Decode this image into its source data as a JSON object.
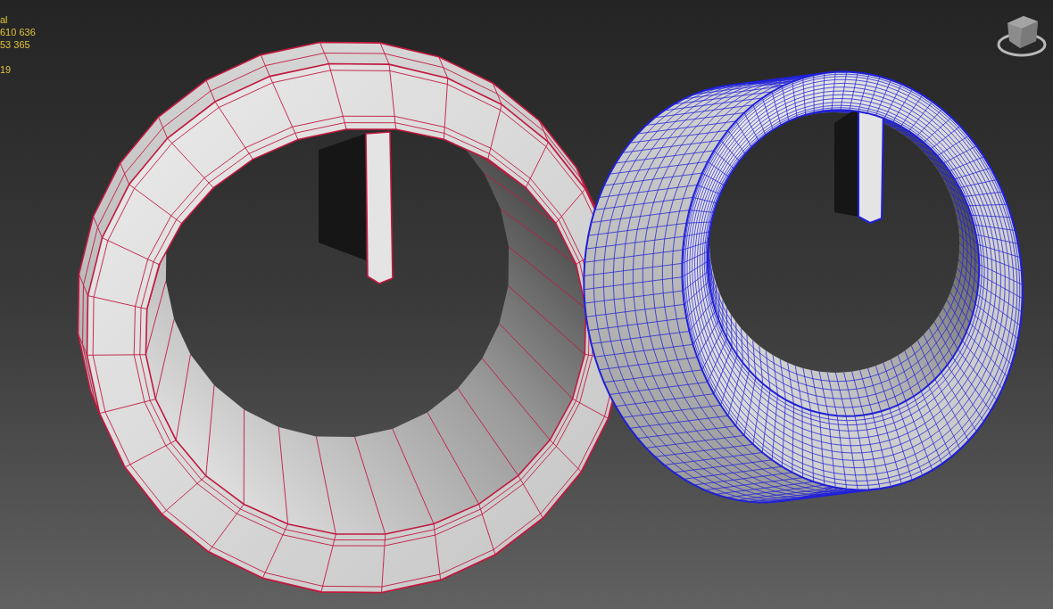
{
  "viewport": {
    "stats": [
      {
        "lines": [
          "al",
          "610 636",
          "53 365"
        ]
      },
      {
        "lines": [
          "19"
        ]
      }
    ]
  },
  "objects": [
    {
      "kind": "lowpoly",
      "color": "#c2183f"
    },
    {
      "kind": "highpoly",
      "color": "#2020d8"
    }
  ]
}
